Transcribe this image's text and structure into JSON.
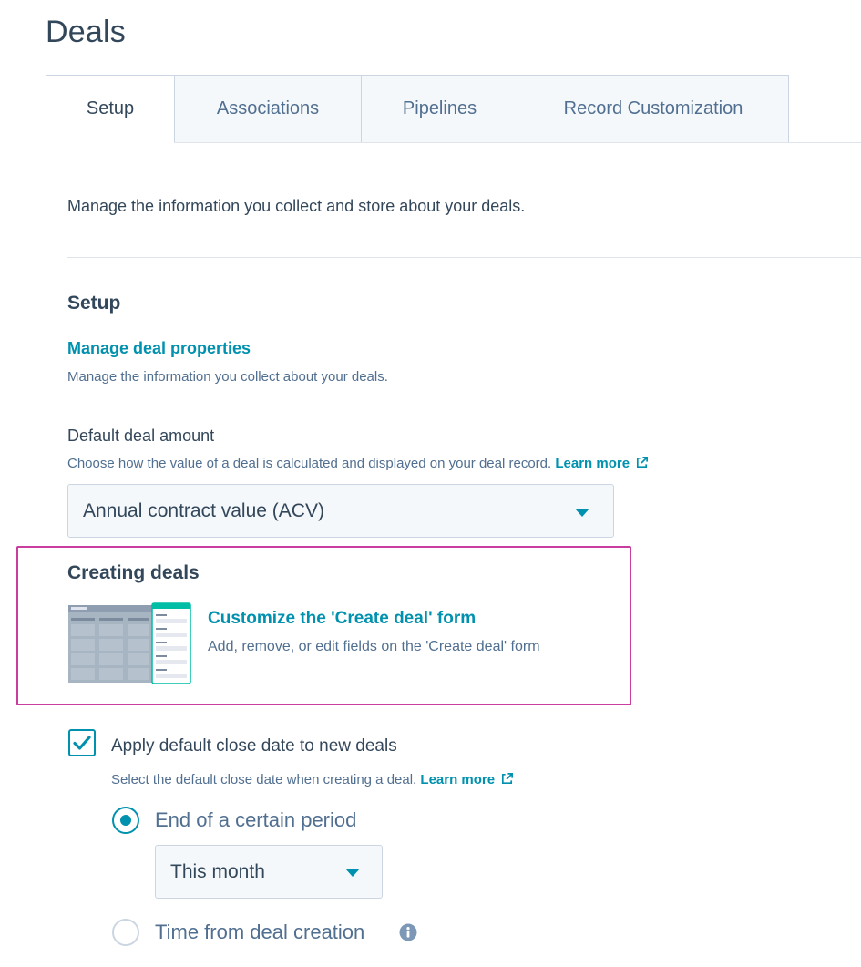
{
  "page": {
    "title": "Deals"
  },
  "tabs": [
    {
      "label": "Setup",
      "active": true
    },
    {
      "label": "Associations",
      "active": false
    },
    {
      "label": "Pipelines",
      "active": false
    },
    {
      "label": "Record Customization",
      "active": false
    }
  ],
  "intro": "Manage the information you collect and store about your deals.",
  "setup": {
    "heading": "Setup",
    "manage_link": "Manage deal properties",
    "manage_desc": "Manage the information you collect about your deals."
  },
  "default_amount": {
    "heading": "Default deal amount",
    "description": "Choose how the value of a deal is calculated and displayed on your deal record.",
    "learn_more": "Learn more",
    "selected": "Annual contract value (ACV)"
  },
  "creating": {
    "heading": "Creating deals",
    "link": "Customize the 'Create deal' form",
    "description": "Add, remove, or edit fields on the 'Create deal' form"
  },
  "close_date": {
    "checkbox_label": "Apply default close date to new deals",
    "checked": true,
    "description": "Select the default close date when creating a deal.",
    "learn_more": "Learn more",
    "option_period": "End of a certain period",
    "period_selected": "This month",
    "option_time": "Time from deal creation",
    "selected_option": "End of a certain period"
  },
  "colors": {
    "link": "#0091ae",
    "text": "#33475b",
    "muted": "#516f90",
    "highlight_border": "#c83d9e"
  },
  "icons": [
    "external-link-icon",
    "chevron-down-icon",
    "checkmark-icon",
    "info-icon"
  ]
}
